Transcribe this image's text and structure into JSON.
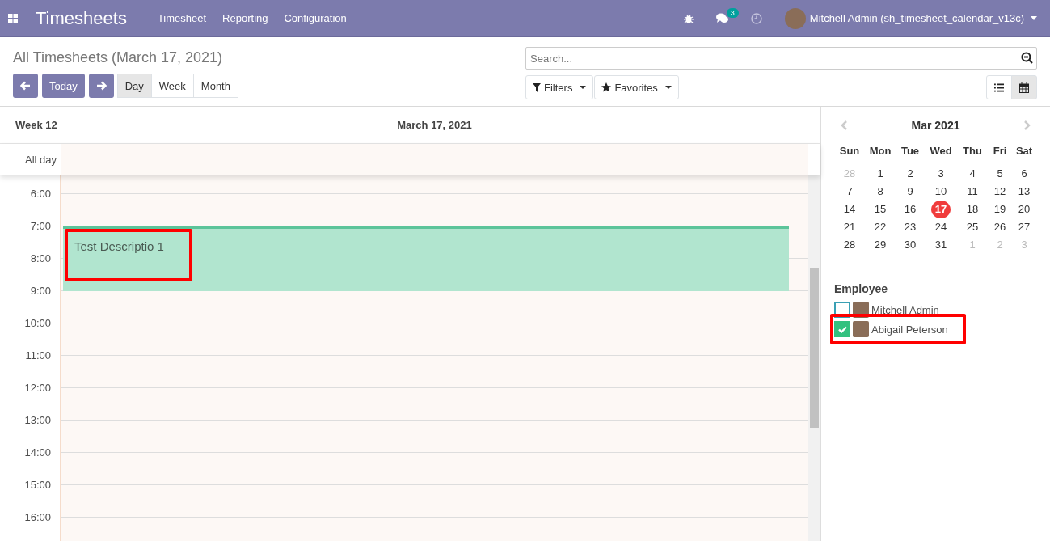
{
  "navbar": {
    "app_title": "Timesheets",
    "menu": [
      "Timesheet",
      "Reporting",
      "Configuration"
    ],
    "chat_count": "3",
    "user": "Mitchell Admin (sh_timesheet_calendar_v13c)"
  },
  "control_panel": {
    "title": "All Timesheets (March 17, 2021)",
    "today": "Today",
    "scales": [
      {
        "label": "Day",
        "selected": true
      },
      {
        "label": "Week",
        "selected": false
      },
      {
        "label": "Month",
        "selected": false
      }
    ],
    "search": {
      "placeholder": "Search..."
    },
    "filters": "Filters",
    "favorites": "Favorites",
    "views": [
      {
        "kind": "list",
        "selected": false
      },
      {
        "kind": "calendar",
        "selected": true
      }
    ]
  },
  "calendar": {
    "week": "Week 12",
    "date": "March 17, 2021",
    "all_day": "All day",
    "hours": [
      {
        "label": "6:00"
      },
      {
        "label": "7:00",
        "events": [
          {
            "title": "Test Descriptio 1",
            "highlighted": true
          }
        ]
      },
      {
        "label": "8:00"
      },
      {
        "label": "9:00"
      },
      {
        "label": "10:00"
      },
      {
        "label": "11:00"
      },
      {
        "label": "12:00"
      },
      {
        "label": "13:00"
      },
      {
        "label": "14:00"
      },
      {
        "label": "15:00"
      },
      {
        "label": "16:00"
      }
    ]
  },
  "sidebar": {
    "month": "Mar 2021",
    "weekdays": [
      "Sun",
      "Mon",
      "Tue",
      "Wed",
      "Thu",
      "Fri",
      "Sat"
    ],
    "days": [
      {
        "label": "28",
        "outside": true,
        "selected": false
      },
      {
        "label": "1",
        "outside": false,
        "selected": false
      },
      {
        "label": "2",
        "outside": false,
        "selected": false
      },
      {
        "label": "3",
        "outside": false,
        "selected": false
      },
      {
        "label": "4",
        "outside": false,
        "selected": false
      },
      {
        "label": "5",
        "outside": false,
        "selected": false
      },
      {
        "label": "6",
        "outside": false,
        "selected": false
      },
      {
        "label": "7",
        "outside": false,
        "selected": false
      },
      {
        "label": "8",
        "outside": false,
        "selected": false
      },
      {
        "label": "9",
        "outside": false,
        "selected": false
      },
      {
        "label": "10",
        "outside": false,
        "selected": false
      },
      {
        "label": "11",
        "outside": false,
        "selected": false
      },
      {
        "label": "12",
        "outside": false,
        "selected": false
      },
      {
        "label": "13",
        "outside": false,
        "selected": false
      },
      {
        "label": "14",
        "outside": false,
        "selected": false
      },
      {
        "label": "15",
        "outside": false,
        "selected": false
      },
      {
        "label": "16",
        "outside": false,
        "selected": false
      },
      {
        "label": "17",
        "outside": false,
        "selected": true
      },
      {
        "label": "18",
        "outside": false,
        "selected": false
      },
      {
        "label": "19",
        "outside": false,
        "selected": false
      },
      {
        "label": "20",
        "outside": false,
        "selected": false
      },
      {
        "label": "21",
        "outside": false,
        "selected": false
      },
      {
        "label": "22",
        "outside": false,
        "selected": false
      },
      {
        "label": "23",
        "outside": false,
        "selected": false
      },
      {
        "label": "24",
        "outside": false,
        "selected": false
      },
      {
        "label": "25",
        "outside": false,
        "selected": false
      },
      {
        "label": "26",
        "outside": false,
        "selected": false
      },
      {
        "label": "27",
        "outside": false,
        "selected": false
      },
      {
        "label": "28",
        "outside": false,
        "selected": false
      },
      {
        "label": "29",
        "outside": false,
        "selected": false
      },
      {
        "label": "30",
        "outside": false,
        "selected": false
      },
      {
        "label": "31",
        "outside": false,
        "selected": false
      },
      {
        "label": "1",
        "outside": true,
        "selected": false
      },
      {
        "label": "2",
        "outside": true,
        "selected": false
      },
      {
        "label": "3",
        "outside": true,
        "selected": false
      }
    ],
    "filter_title": "Employee",
    "employees": [
      {
        "name": "Mitchell Admin",
        "checked": false,
        "highlighted": false
      },
      {
        "name": "Abigail Peterson",
        "checked": true,
        "highlighted": true
      }
    ]
  }
}
